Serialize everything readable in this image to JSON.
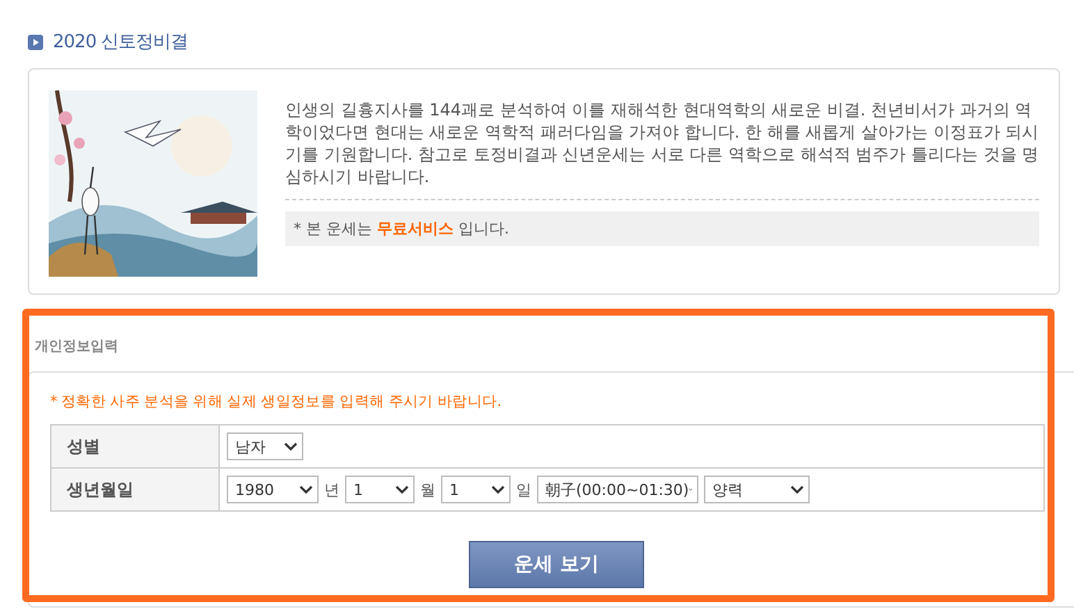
{
  "section_title": "2020 신토정비결",
  "intro": {
    "kind": "picture",
    "description": "인생의 길흉지사를 144괘로 분석하여 이를 재해석한 현대역학의 새로운 비결. 천년비서가 과거의 역학이었다면 현대는 새로운 역학적 패러다임을 가져야 합니다. 한 해를 새롭게 살아가는 이정표가 되시기를 기원합니다. 참고로 토정비결과 신년운세는 서로 다른 역학으로 해석적 범주가 틀리다는 것을 명심하시기 바랍니다.",
    "notice": "* 본 운세는 **무료서비스** 입니다."
  },
  "form": {
    "heading": "개인정보입력",
    "hint": "* 정확한 사주 분석을 위해 실제 생일정보를 입력해 주시기 바랍니다.",
    "rows": [
      {
        "label": "성별",
        "controls": [
          {
            "kind": "select",
            "value": "남자"
          }
        ]
      },
      {
        "label": "생년월일",
        "controls": [
          {
            "kind": "select",
            "value": "1980"
          },
          {
            "kind": "unit",
            "text": "년"
          },
          {
            "kind": "select",
            "value": "1"
          },
          {
            "kind": "unit",
            "text": "월"
          },
          {
            "kind": "select",
            "value": "1"
          },
          {
            "kind": "unit",
            "text": "일"
          },
          {
            "kind": "select",
            "value": "朝子(00:00~01:30)"
          },
          {
            "kind": "select",
            "value": "양력"
          }
        ]
      }
    ],
    "submit": "운세 보기"
  }
}
